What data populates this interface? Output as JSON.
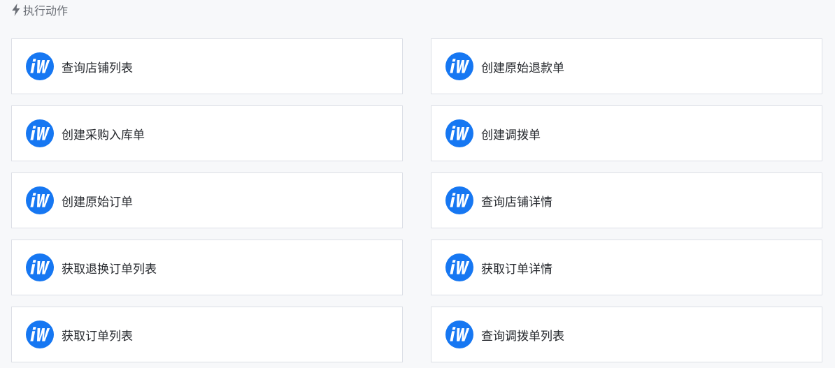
{
  "section": {
    "title": "执行动作",
    "icon": "lightning-icon"
  },
  "brand": {
    "logo_icon": "jushuitan-logo-icon",
    "logo_color": "#1677f2"
  },
  "actions": [
    {
      "label": "查询店铺列表"
    },
    {
      "label": "创建原始退款单"
    },
    {
      "label": "创建采购入库单"
    },
    {
      "label": "创建调拨单"
    },
    {
      "label": "创建原始订单"
    },
    {
      "label": "查询店铺详情"
    },
    {
      "label": "获取退换订单列表"
    },
    {
      "label": "获取订单详情"
    },
    {
      "label": "获取订单列表"
    },
    {
      "label": "查询调拨单列表"
    }
  ]
}
